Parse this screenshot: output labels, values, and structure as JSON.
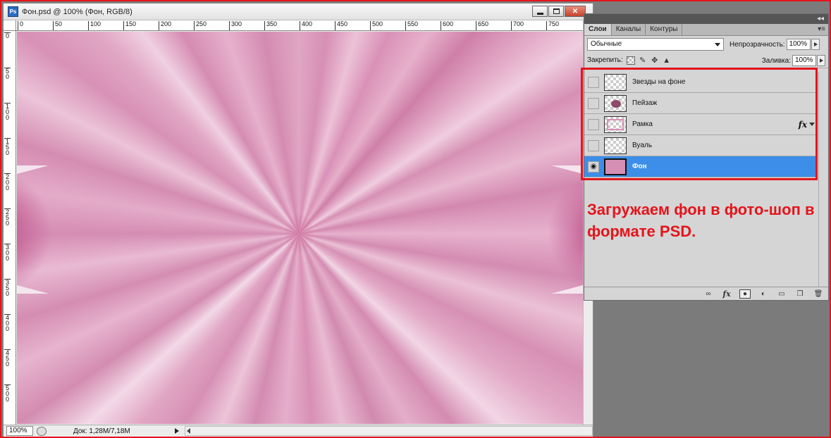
{
  "document": {
    "title": "Фон.psd @ 100% (Фон, RGB/8)",
    "app_icon": "Ps",
    "ruler_top": [
      "0",
      "50",
      "100",
      "150",
      "200",
      "250",
      "300",
      "350",
      "400",
      "450",
      "500",
      "550",
      "600",
      "650",
      "700",
      "750"
    ],
    "ruler_left": [
      "0",
      "50",
      "100",
      "150",
      "200",
      "250",
      "300",
      "350",
      "400",
      "450",
      "500"
    ],
    "zoom": "100%",
    "doc_info": "Док: 1,28M/7,18M"
  },
  "layers_panel": {
    "tabs": [
      "Слои",
      "Каналы",
      "Контуры"
    ],
    "blend_mode": "Обычные",
    "opacity_label": "Непрозрачность:",
    "opacity_value": "100%",
    "lock_label": "Закрепить:",
    "fill_label": "Заливка:",
    "fill_value": "100%",
    "layers": [
      {
        "name": "Звезды на фоне",
        "visible": false,
        "selected": false,
        "fx": false
      },
      {
        "name": "Пейзаж",
        "visible": false,
        "selected": false,
        "fx": false
      },
      {
        "name": "Рамка",
        "visible": false,
        "selected": false,
        "fx": true,
        "fx_label": "fx"
      },
      {
        "name": "Вуаль",
        "visible": false,
        "selected": false,
        "fx": false
      },
      {
        "name": "Фон",
        "visible": true,
        "selected": true,
        "fx": false
      }
    ],
    "bottom_fx": "fx"
  },
  "annotation": {
    "text": "Загружаем фон в фото-шоп в формате PSD.",
    "color": "#e4141b"
  },
  "colors": {
    "selection": "#3d8ee8",
    "canvas_pink": "#d68fb4",
    "accent_red": "#e4141b"
  }
}
